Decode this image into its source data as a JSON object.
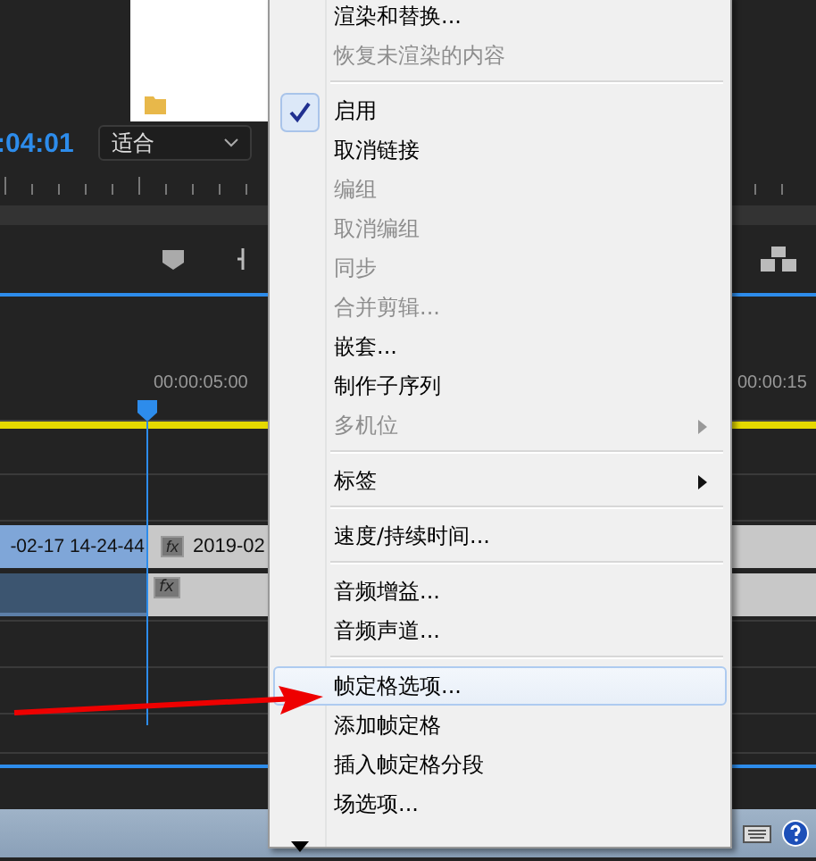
{
  "program": {
    "timecode": ":04:01",
    "zoom_dropdown": "适合",
    "ruler_labels": [
      "00:00:05:00",
      "00:00:15"
    ],
    "video_clips": [
      {
        "label": "-02-17 14-24-44",
        "selected": true
      },
      {
        "label": "2019-02",
        "badge": "fx",
        "selected": false
      }
    ],
    "audio_clips": [
      {
        "selected": true
      },
      {
        "badge": "fx",
        "selected": false
      }
    ]
  },
  "context_menu": {
    "items": [
      {
        "kind": "item",
        "label": "渲染和替换...",
        "disabled": false,
        "checked": false,
        "submenu": false,
        "selected": false
      },
      {
        "kind": "item",
        "label": "恢复未渲染的内容",
        "disabled": true,
        "checked": false,
        "submenu": false,
        "selected": false
      },
      {
        "kind": "separator"
      },
      {
        "kind": "item",
        "label": "启用",
        "disabled": false,
        "checked": true,
        "submenu": false,
        "selected": false
      },
      {
        "kind": "item",
        "label": "取消链接",
        "disabled": false,
        "checked": false,
        "submenu": false,
        "selected": false
      },
      {
        "kind": "item",
        "label": "编组",
        "disabled": true,
        "checked": false,
        "submenu": false,
        "selected": false
      },
      {
        "kind": "item",
        "label": "取消编组",
        "disabled": true,
        "checked": false,
        "submenu": false,
        "selected": false
      },
      {
        "kind": "item",
        "label": "同步",
        "disabled": true,
        "checked": false,
        "submenu": false,
        "selected": false
      },
      {
        "kind": "item",
        "label": "合并剪辑...",
        "disabled": true,
        "checked": false,
        "submenu": false,
        "selected": false
      },
      {
        "kind": "item",
        "label": "嵌套...",
        "disabled": false,
        "checked": false,
        "submenu": false,
        "selected": false
      },
      {
        "kind": "item",
        "label": "制作子序列",
        "disabled": false,
        "checked": false,
        "submenu": false,
        "selected": false
      },
      {
        "kind": "item",
        "label": "多机位",
        "disabled": true,
        "checked": false,
        "submenu": true,
        "selected": false
      },
      {
        "kind": "separator"
      },
      {
        "kind": "item",
        "label": "标签",
        "disabled": false,
        "checked": false,
        "submenu": true,
        "selected": false
      },
      {
        "kind": "separator"
      },
      {
        "kind": "item",
        "label": "速度/持续时间...",
        "disabled": false,
        "checked": false,
        "submenu": false,
        "selected": false
      },
      {
        "kind": "separator"
      },
      {
        "kind": "item",
        "label": "音频增益...",
        "disabled": false,
        "checked": false,
        "submenu": false,
        "selected": false
      },
      {
        "kind": "item",
        "label": "音频声道...",
        "disabled": false,
        "checked": false,
        "submenu": false,
        "selected": false
      },
      {
        "kind": "separator"
      },
      {
        "kind": "item",
        "label": "帧定格选项...",
        "disabled": false,
        "checked": false,
        "submenu": false,
        "selected": true
      },
      {
        "kind": "item",
        "label": "添加帧定格",
        "disabled": false,
        "checked": false,
        "submenu": false,
        "selected": false
      },
      {
        "kind": "item",
        "label": "插入帧定格分段",
        "disabled": false,
        "checked": false,
        "submenu": false,
        "selected": false
      },
      {
        "kind": "item",
        "label": "场选项...",
        "disabled": false,
        "checked": false,
        "submenu": false,
        "selected": false
      }
    ],
    "scroll_down": true
  }
}
